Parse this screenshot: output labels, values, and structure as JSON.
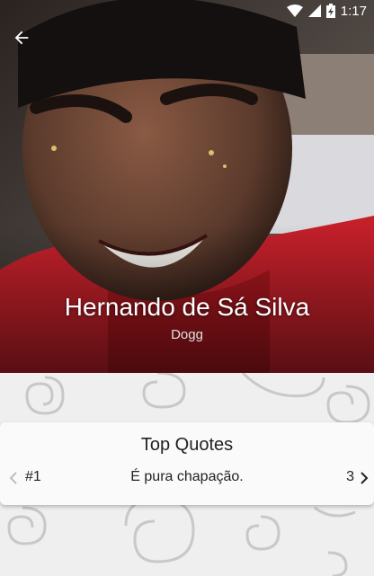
{
  "status_bar": {
    "time": "1:17"
  },
  "profile": {
    "name": "Hernando de Sá Silva",
    "subtitle": "Dogg"
  },
  "quotes_card": {
    "title": "Top Quotes",
    "current_index": "#1",
    "quote_text": "É pura chapação.",
    "total_count": "3"
  },
  "icons": {
    "back": "arrow-left-icon",
    "prev": "chevron-left-icon",
    "next": "chevron-right-icon",
    "wifi": "wifi-icon",
    "signal": "signal-icon",
    "battery": "battery-charging-icon"
  },
  "colors": {
    "shirt_red": "#c4202a",
    "background": "#efefef",
    "card": "#fafafa"
  }
}
